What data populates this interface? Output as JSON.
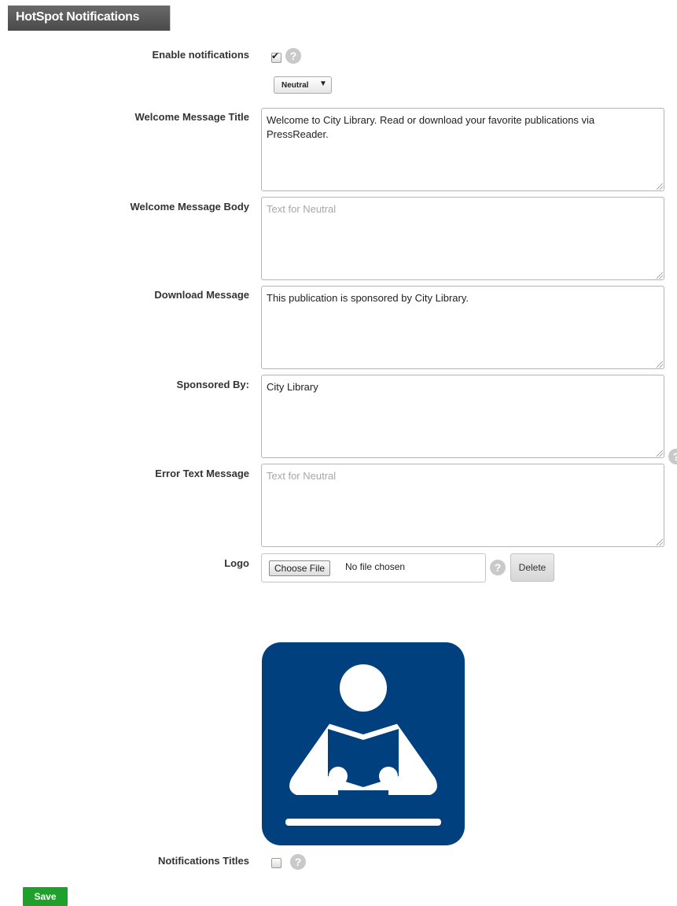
{
  "header": {
    "title": "HotSpot Notifications"
  },
  "enable_notifications": {
    "label": "Enable notifications",
    "checked": true
  },
  "language_select": {
    "value": "Neutral",
    "arrow": "▼"
  },
  "fields": {
    "welcome_title": {
      "label": "Welcome Message Title",
      "value": "Welcome to City Library. Read or download your favorite publications via PressReader."
    },
    "welcome_body": {
      "label": "Welcome Message Body",
      "placeholder": "Text for Neutral",
      "value": ""
    },
    "download_message": {
      "label": "Download Message",
      "value": "This publication is sponsored by City Library."
    },
    "sponsored_by": {
      "label": "Sponsored By:",
      "value": "City Library"
    },
    "error_text": {
      "label": "Error Text Message",
      "placeholder": "Text for Neutral",
      "value": ""
    }
  },
  "logo_field": {
    "label": "Logo",
    "choose_button": "Choose File",
    "file_status": "No file chosen",
    "delete_button": "Delete"
  },
  "logo_image": {
    "icon": "library-reader-icon",
    "background_color": "#00407f"
  },
  "notifications_titles": {
    "label": "Notifications Titles",
    "checked": false
  },
  "help_icon": {
    "glyph": "?"
  },
  "check_glyph": "✔",
  "save_button": "Save"
}
